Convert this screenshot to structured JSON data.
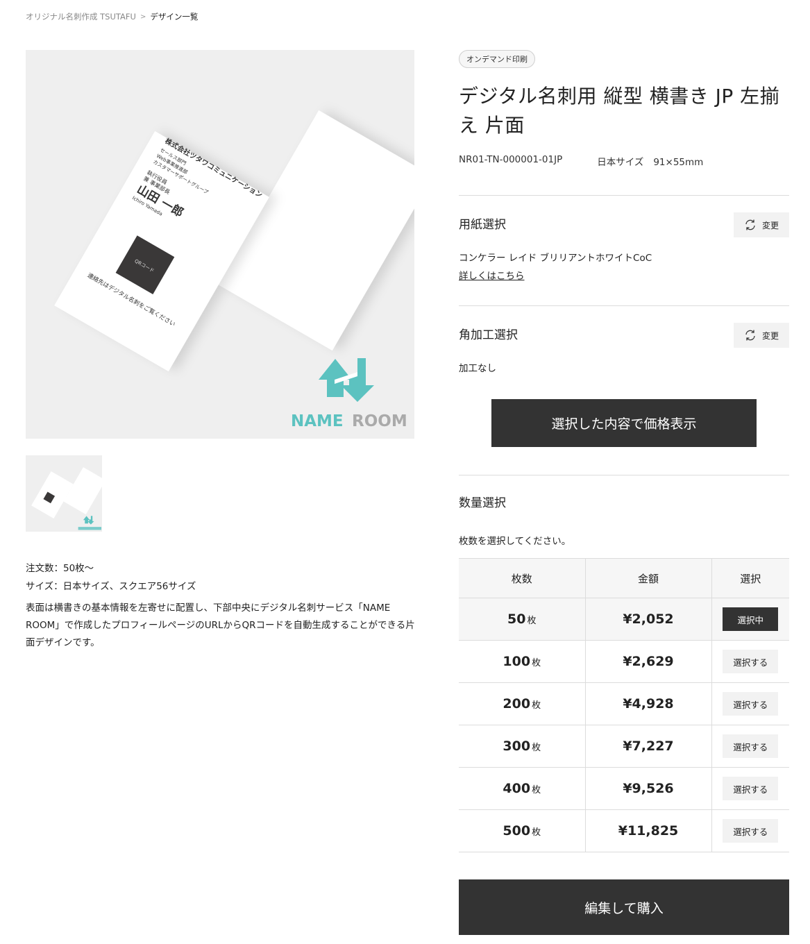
{
  "breadcrumb": {
    "home": "オリジナル名刺作成 TSUTAFU",
    "separator": ">",
    "current": "デザイン一覧"
  },
  "preview": {
    "card_company": "株式会社ツタワコミュニケーション",
    "card_dept1": "セールス部門",
    "card_dept2": "Web事業推進部",
    "card_dept3": "カスタマーサポートグループ",
    "card_role1": "執行役員",
    "card_role2": "兼 事業部長",
    "card_name": "山田 一郎",
    "card_romaji": "Ichiro Yamada",
    "card_qr": "QRコード",
    "card_footer": "連絡先はデジタル名刺をご覧ください",
    "logo_text_1": "NAME",
    "logo_text_2": "ROOM",
    "logo_color": "#5cc2c0"
  },
  "description": {
    "order_qty": "注文数：50枚〜",
    "sizes": "サイズ：日本サイズ、スクエア56サイズ",
    "body": "表面は横書きの基本情報を左寄せに配置し、下部中央にデジタル名刺サービス「NAME ROOM」で作成したプロフィールページのURLからQRコードを自動生成することができる片面デザインです。"
  },
  "product": {
    "tag": "オンデマンド印刷",
    "title": "デジタル名刺用 縦型 横書き JP 左揃え 片面",
    "code": "NR01-TN-000001-01JP",
    "size_label": "日本サイズ",
    "size_value": "91×55mm"
  },
  "paper": {
    "heading": "用紙選択",
    "change_label": "変更",
    "value": "コンケラー レイド ブリリアントホワイトCoC",
    "detail_link": "詳しくはこちら"
  },
  "corner": {
    "heading": "角加工選択",
    "change_label": "変更",
    "value": "加工なし"
  },
  "price_button": "選択した内容で価格表示",
  "quantity": {
    "heading": "数量選択",
    "note": "枚数を選択してください。",
    "columns": [
      "枚数",
      "金額",
      "選択"
    ],
    "unit": "枚",
    "rows": [
      {
        "count": "50",
        "price": "¥2,052",
        "action": "選択中",
        "selected": true
      },
      {
        "count": "100",
        "price": "¥2,629",
        "action": "選択する",
        "selected": false
      },
      {
        "count": "200",
        "price": "¥4,928",
        "action": "選択する",
        "selected": false
      },
      {
        "count": "300",
        "price": "¥7,227",
        "action": "選択する",
        "selected": false
      },
      {
        "count": "400",
        "price": "¥9,526",
        "action": "選択する",
        "selected": false
      },
      {
        "count": "500",
        "price": "¥11,825",
        "action": "選択する",
        "selected": false
      }
    ]
  },
  "buy_button": "編集して購入"
}
